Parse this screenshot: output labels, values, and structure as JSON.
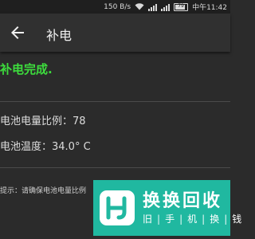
{
  "status_bar": {
    "speed": "150 B/s",
    "battery_level": "79",
    "carrier_time": "中午11:42"
  },
  "app_bar": {
    "back_icon": "arrow-left-icon",
    "title": "补电"
  },
  "content": {
    "status_message": "补电完成.",
    "battery_ratio": "电池电量比例：78",
    "battery_temp": "电池温度：34.0° C",
    "tip": "提示：请确保电池电量比例"
  },
  "watermark": {
    "title": "换换回收",
    "subtitle_chars": [
      "旧",
      "手",
      "机",
      "换",
      "钱"
    ],
    "color": "#20b8a0"
  }
}
